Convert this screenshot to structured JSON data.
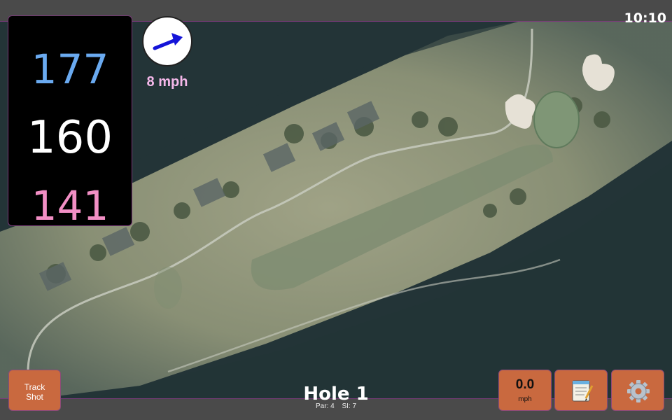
{
  "status": {
    "time": "10:10"
  },
  "distances": {
    "back": "177",
    "middle": "160",
    "front": "141"
  },
  "wind": {
    "speed_label": "8 mph",
    "direction_icon": "wind-arrow-icon"
  },
  "hole": {
    "title": "Hole 1",
    "par": "Par: 4",
    "stroke_index": "SI: 7"
  },
  "buttons": {
    "track_shot_line1": "Track",
    "track_shot_line2": "Shot",
    "speed_value": "0.0",
    "speed_unit": "mph",
    "notes_icon": "notepad-icon",
    "settings_icon": "gear-icon"
  },
  "colors": {
    "back": "#6aaaf0",
    "middle": "#ffffff",
    "front": "#f28fc5",
    "button": "#c9693f",
    "wind_label": "#f5b8ea"
  }
}
